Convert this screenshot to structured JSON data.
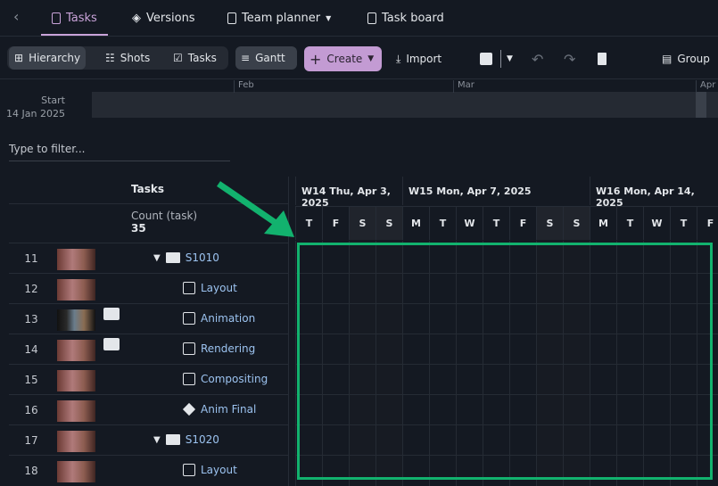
{
  "nav": {
    "back": "‹",
    "tabs": [
      {
        "label": "Tasks",
        "active": true
      },
      {
        "label": "Versions"
      },
      {
        "label": "Team planner"
      },
      {
        "label": "Task board"
      }
    ]
  },
  "toolbar": {
    "hierarchy": "Hierarchy",
    "shots": "Shots",
    "tasks": "Tasks",
    "gantt": "Gantt",
    "create": "Create",
    "import": "Import",
    "group": "Group"
  },
  "timeline": {
    "start_label": "Start",
    "start_date": "14 Jan 2025",
    "months": [
      "Feb",
      "Mar",
      "Apr"
    ]
  },
  "filter": {
    "placeholder": "Type to filter..."
  },
  "table": {
    "column": "Tasks",
    "count_label": "Count (task)",
    "count": "35",
    "rows": [
      {
        "num": "11",
        "name": "S1010",
        "type": "shot",
        "comment": false
      },
      {
        "num": "12",
        "name": "Layout",
        "type": "task",
        "comment": false
      },
      {
        "num": "13",
        "name": "Animation",
        "type": "task",
        "comment": true
      },
      {
        "num": "14",
        "name": "Rendering",
        "type": "task",
        "comment": true
      },
      {
        "num": "15",
        "name": "Compositing",
        "type": "task",
        "comment": false
      },
      {
        "num": "16",
        "name": "Anim Final",
        "type": "milestone",
        "comment": false
      },
      {
        "num": "17",
        "name": "S1020",
        "type": "shot",
        "comment": false
      },
      {
        "num": "18",
        "name": "Layout",
        "type": "task",
        "comment": false
      }
    ]
  },
  "gantt": {
    "weeks": [
      "W14 Thu, Apr 3, 2025",
      "W15 Mon, Apr 7, 2025",
      "W16 Mon, Apr 14, 2025"
    ],
    "days": [
      "T",
      "F",
      "S",
      "S",
      "M",
      "T",
      "W",
      "T",
      "F",
      "S",
      "S",
      "M",
      "T",
      "W",
      "T",
      "F"
    ]
  },
  "colors": {
    "accent": "#c9a3d9",
    "annotation": "#12b26e",
    "link": "#9cc3f0"
  }
}
